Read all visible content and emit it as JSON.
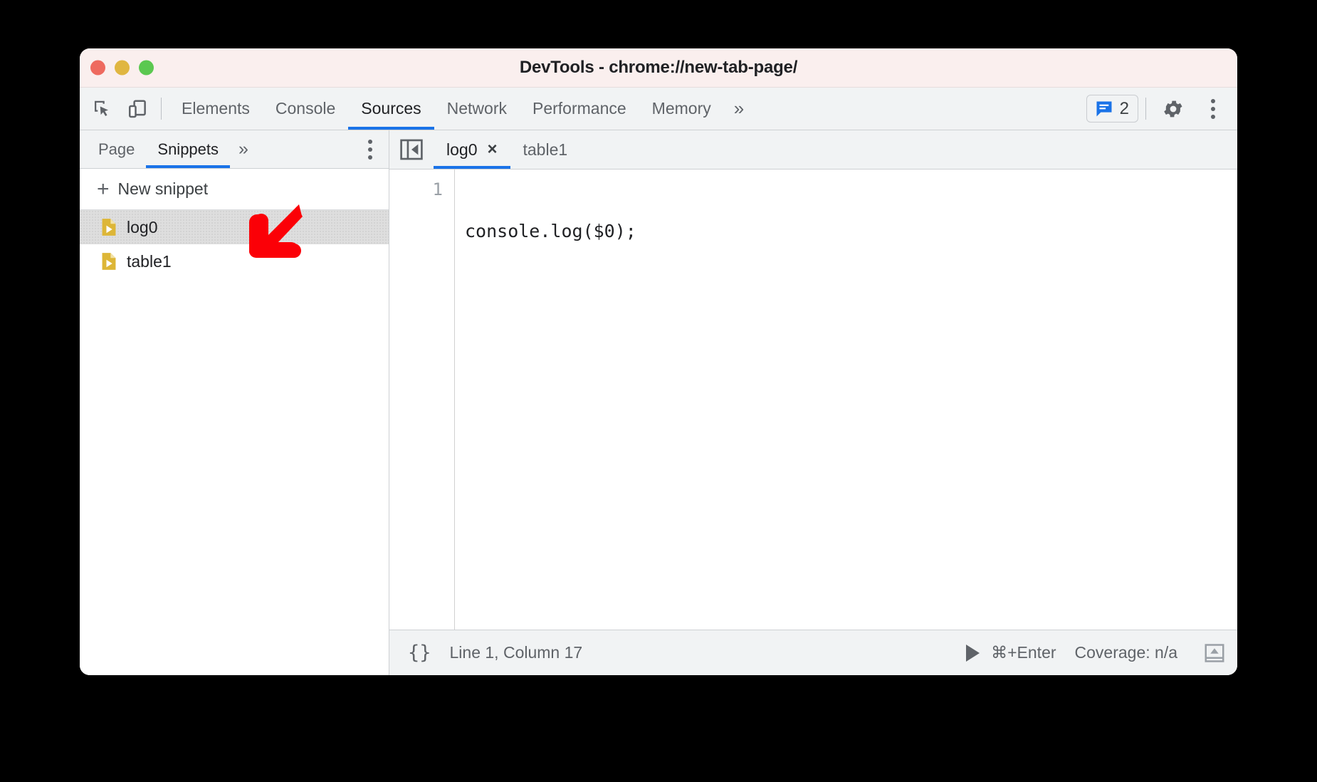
{
  "window": {
    "title": "DevTools - chrome://new-tab-page/",
    "traffic_lights": [
      "close",
      "minimize",
      "maximize"
    ]
  },
  "toolbar": {
    "inspect_icon": "inspect-element-icon",
    "device_icon": "device-toolbar-icon",
    "tabs": [
      {
        "label": "Elements",
        "active": false
      },
      {
        "label": "Console",
        "active": false
      },
      {
        "label": "Sources",
        "active": true
      },
      {
        "label": "Network",
        "active": false
      },
      {
        "label": "Performance",
        "active": false
      },
      {
        "label": "Memory",
        "active": false
      }
    ],
    "more_tabs_label": "»",
    "issues": {
      "icon": "issues-message-icon",
      "count": "2",
      "color": "#1a73e8"
    },
    "settings_icon": "gear-icon",
    "menu_icon": "kebab-menu-icon"
  },
  "navigator": {
    "tabs": [
      {
        "label": "Page",
        "active": false
      },
      {
        "label": "Snippets",
        "active": true
      }
    ],
    "more_tabs_label": "»",
    "menu_icon": "kebab-menu-icon",
    "new_snippet": {
      "label": "New snippet",
      "icon": "plus-icon"
    },
    "snippets": [
      {
        "name": "log0",
        "icon": "snippet-file-icon",
        "selected": true
      },
      {
        "name": "table1",
        "icon": "snippet-file-icon",
        "selected": false
      }
    ]
  },
  "editor": {
    "collapse_icon": "collapse-sidebar-icon",
    "tabs": [
      {
        "label": "log0",
        "active": true,
        "closable": true,
        "close_label": "×"
      },
      {
        "label": "table1",
        "active": false,
        "closable": false,
        "close_label": ""
      }
    ],
    "lines": [
      {
        "number": "1",
        "text": "console.log($0);"
      }
    ]
  },
  "status_bar": {
    "format_icon": "pretty-print-braces-icon",
    "format_label": "{}",
    "cursor_position": "Line 1, Column 17",
    "run_icon": "run-snippet-play-icon",
    "run_shortcut": "⌘+Enter",
    "coverage": "Coverage: n/a",
    "drawer_icon": "show-drawer-icon"
  },
  "annotation": {
    "arrow": {
      "name": "red-pointer-arrow",
      "direction": "down-left",
      "color": "#fb0007"
    }
  },
  "colors": {
    "accent": "#1a73e8",
    "titlebar": "#faefee",
    "chrome_bg": "#f1f3f4",
    "selected_row": "#dedede",
    "snippet_icon": "#ddb637"
  }
}
